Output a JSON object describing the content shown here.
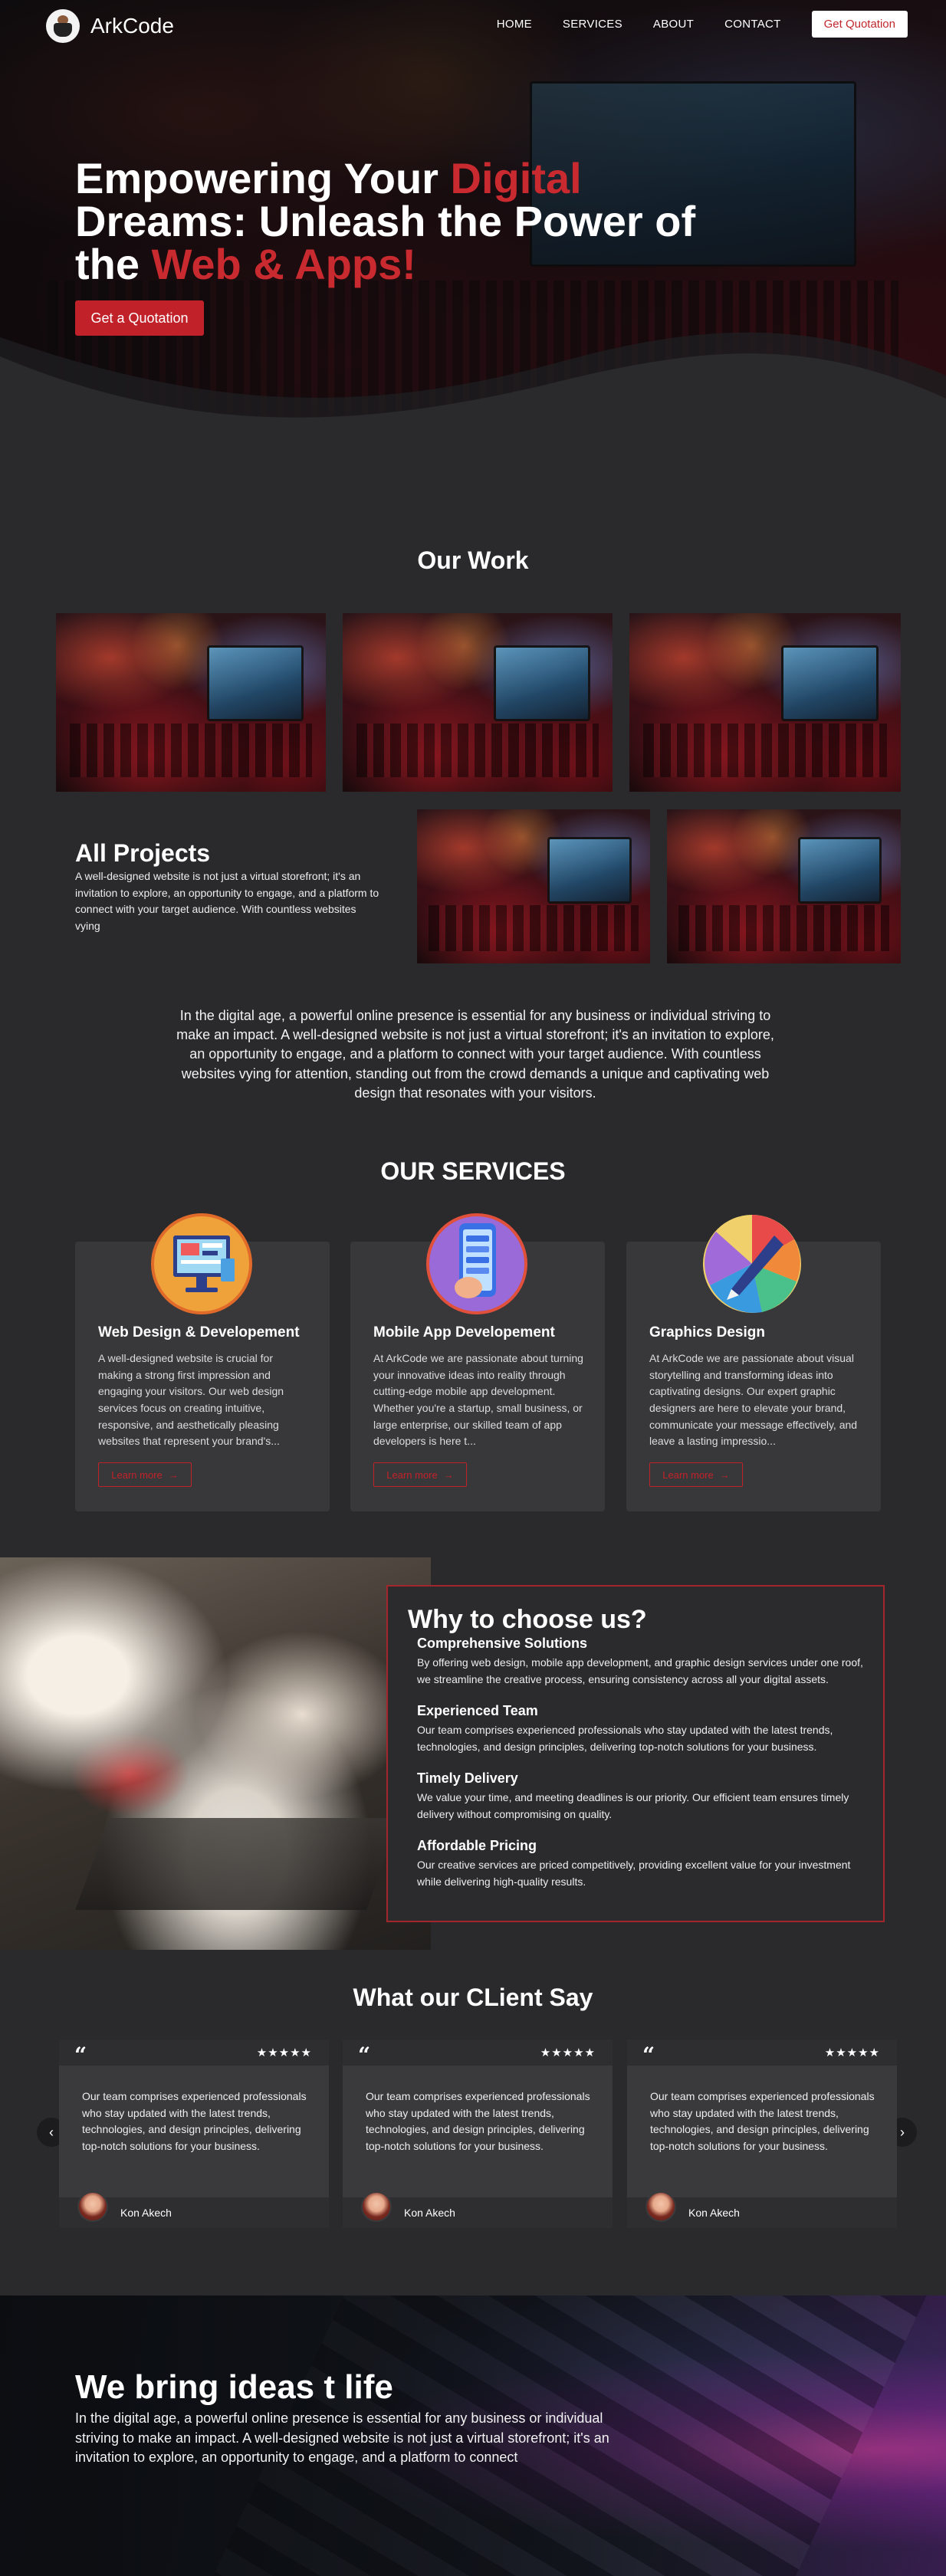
{
  "header": {
    "brand": "ArkCode",
    "nav": [
      "HOME",
      "SERVICES",
      "ABOUT",
      "CONTACT"
    ],
    "cta": "Get Quotation"
  },
  "hero": {
    "title_part1": "Empowering Your ",
    "title_highlight1": "Digital",
    "title_part2": " Dreams: Unleash the Power of the ",
    "title_highlight2": "Web & Apps!",
    "button": "Get a Quotation"
  },
  "work": {
    "title": "Our Work",
    "all_projects_title": "All Projects",
    "all_projects_desc": "A well-designed website is not just a virtual storefront; it's an invitation to explore, an opportunity to engage, and a platform to connect with your target audience. With countless websites vying",
    "intro": "In the digital age, a powerful online presence is essential for any business or individual striving to make an impact. A well-designed website is not just a virtual storefront; it's an invitation to explore, an opportunity to engage, and a platform to connect with your target audience. With countless websites vying for attention, standing out from the crowd demands a unique and captivating web design that resonates with your visitors."
  },
  "services": {
    "title": "OUR SERVICES",
    "learn_more": "Learn more",
    "items": [
      {
        "title": "Web Design & Developement",
        "desc": "A well-designed website is crucial for making a strong first impression and engaging your visitors. Our web design services focus on creating intuitive, responsive, and aesthetically pleasing websites that represent your brand's..."
      },
      {
        "title": "Mobile App Developement",
        "desc": "At ArkCode we are passionate about turning your innovative ideas into reality through cutting-edge mobile app development. Whether you're a startup, small business, or large enterprise, our skilled team of app developers is here t..."
      },
      {
        "title": "Graphics Design",
        "desc": "At ArkCode we are passionate about visual storytelling and transforming ideas into captivating designs. Our expert graphic designers are here to elevate your brand, communicate your message effectively, and leave a lasting impressio..."
      }
    ]
  },
  "why": {
    "title": "Why to choose us?",
    "items": [
      {
        "title": "Comprehensive Solutions",
        "text": "By offering web design, mobile app development, and graphic design services under one roof, we streamline the creative process, ensuring consistency across all your digital assets."
      },
      {
        "title": "Experienced Team",
        "text": "Our team comprises experienced professionals who stay updated with the latest trends, technologies, and design principles, delivering top-notch solutions for your business."
      },
      {
        "title": "Timely Delivery",
        "text": "We value your time, and meeting deadlines is our priority. Our efficient team ensures timely delivery without compromising on quality."
      },
      {
        "title": "Affordable Pricing",
        "text": "Our creative services are priced competitively, providing excellent value for your investment while delivering high-quality results."
      }
    ]
  },
  "testimonials": {
    "title": "What our CLient Say",
    "quote_mark": "“",
    "stars": "★★★★★",
    "prev": "‹",
    "next": "›",
    "items": [
      {
        "text": "Our team comprises experienced professionals who stay updated with the latest trends, technologies, and design principles, delivering top-notch solutions for your business.",
        "name": "Kon Akech"
      },
      {
        "text": "Our team comprises experienced professionals who stay updated with the latest trends, technologies, and design principles, delivering top-notch solutions for your business.",
        "name": "Kon Akech"
      },
      {
        "text": "Our team comprises experienced professionals who stay updated with the latest trends, technologies, and design principles, delivering top-notch solutions for your business.",
        "name": "Kon Akech"
      }
    ]
  },
  "banner": {
    "title": "We bring ideas t life",
    "text": "In the digital age, a powerful online presence is essential for any business or individual striving to make an impact. A well-designed website is not just a virtual storefront; it's an invitation to explore, an opportunity to engage, and a platform to connect"
  },
  "colors": {
    "accent": "#c1222a",
    "background": "#2a2a2c",
    "card": "#38383a"
  }
}
